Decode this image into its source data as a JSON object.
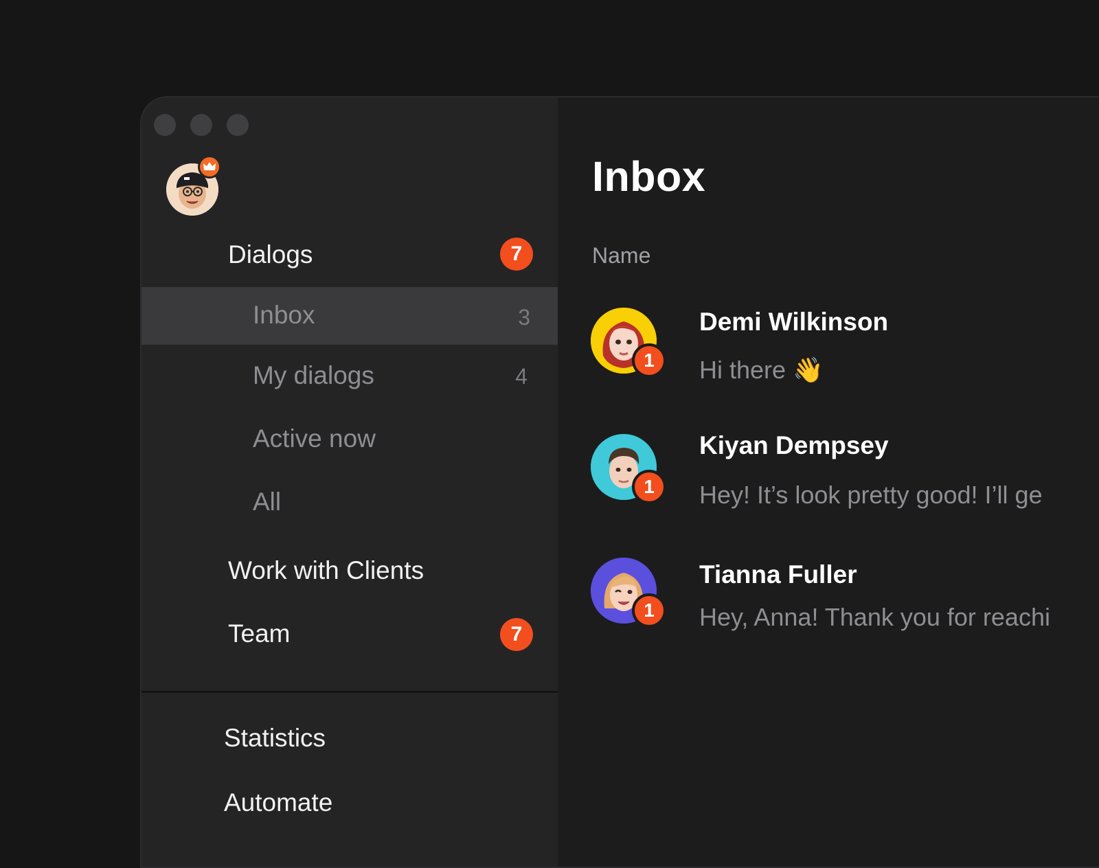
{
  "sidebar": {
    "dialogs": {
      "label": "Dialogs",
      "badge": "7"
    },
    "sub_items": [
      {
        "label": "Inbox",
        "count": "3"
      },
      {
        "label": "My dialogs",
        "count": "4"
      },
      {
        "label": "Active now",
        "count": ""
      },
      {
        "label": "All",
        "count": ""
      }
    ],
    "work_with_clients": {
      "label": "Work with Clients"
    },
    "team": {
      "label": "Team",
      "badge": "7"
    },
    "statistics": {
      "label": "Statistics"
    },
    "automate": {
      "label": "Automate"
    }
  },
  "main": {
    "title": "Inbox",
    "column_header": "Name",
    "conversations": [
      {
        "name": "Demi Wilkinson",
        "preview": "Hi there 👋",
        "unread": "1",
        "avatar_color": "#f9cf05"
      },
      {
        "name": "Kiyan Dempsey",
        "preview": "Hey! It’s look pretty good! I’ll ge",
        "unread": "1",
        "avatar_color": "#3fc9d9"
      },
      {
        "name": "Tianna Fuller",
        "preview": "Hey, Anna! Thank you for reachi",
        "unread": "1",
        "avatar_color": "#5b4fde"
      }
    ]
  },
  "colors": {
    "accent_badge": "#f24e1e",
    "crown_badge": "#f46b23",
    "background": "#161617",
    "sidebar": "#242425",
    "active_item": "#3a3a3c"
  },
  "icons": [
    "crown-icon",
    "user-avatar",
    "memoji-avatar"
  ]
}
